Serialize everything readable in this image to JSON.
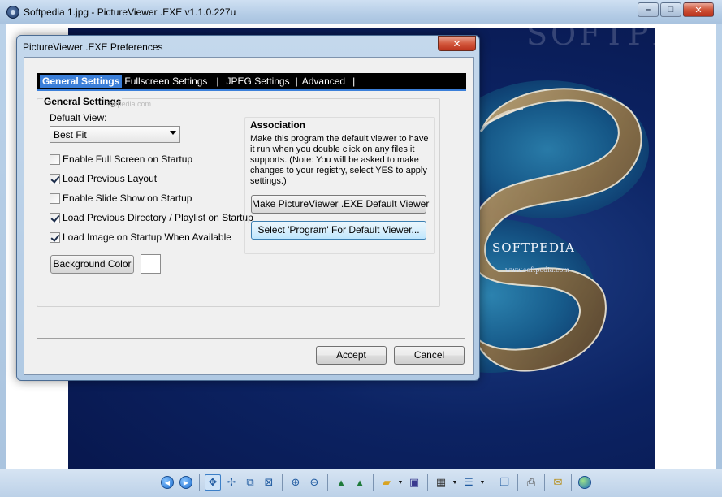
{
  "window": {
    "title": "Softpedia 1.jpg - PictureViewer .EXE v1.1.0.227u",
    "minimize_glyph": "–",
    "maximize_glyph": "□",
    "close_glyph": "✕"
  },
  "picture": {
    "watermark": "SOFTPEDIA",
    "brand": "SOFTPEDIA",
    "url": "www.softpedia.com"
  },
  "dialog": {
    "title": "PictureViewer .EXE Preferences",
    "close_glyph": "✕",
    "tabs": [
      {
        "label": "General Settings",
        "active": true
      },
      {
        "label": "Fullscreen Settings",
        "active": false
      },
      {
        "label": "JPEG Settings",
        "active": false
      },
      {
        "label": "Advanced",
        "active": false
      }
    ],
    "tab_separator": "|",
    "general": {
      "heading": "General Settings",
      "heading_ghost": "softpedia.com",
      "default_view_label": "Defualt View:",
      "default_view_value": "Best Fit",
      "checkboxes": [
        {
          "label": "Enable Full Screen on Startup",
          "checked": false
        },
        {
          "label": "Load Previous Layout",
          "checked": true
        },
        {
          "label": "Enable Slide Show on Startup",
          "checked": false
        },
        {
          "label": "Load Previous Directory / Playlist on Startup",
          "checked": true
        },
        {
          "label": "Load Image on Startup When Available",
          "checked": true
        }
      ],
      "background_color_label": "Background Color",
      "background_color": "#ffffff"
    },
    "association": {
      "heading": "Association",
      "description": "Make this program the default viewer to have it run when you double click on any files it supports. (Note: You will be asked to make changes to your registry, select YES to apply settings.)",
      "make_default_label": "Make PictureViewer .EXE Default Viewer",
      "select_program_label": "Select 'Program' For Default Viewer..."
    },
    "accept_label": "Accept",
    "cancel_label": "Cancel"
  },
  "toolbar": {
    "icons": [
      "previous-icon",
      "next-icon",
      "fit-icon",
      "actual-size-icon",
      "stretch-icon",
      "clear-icon",
      "zoom-in-icon",
      "zoom-out-icon",
      "rotate-left-icon",
      "rotate-right-icon",
      "open-folder-icon",
      "save-icon",
      "slideshow-icon",
      "playlist-icon",
      "copy-icon",
      "print-icon",
      "email-icon",
      "web-icon"
    ]
  }
}
